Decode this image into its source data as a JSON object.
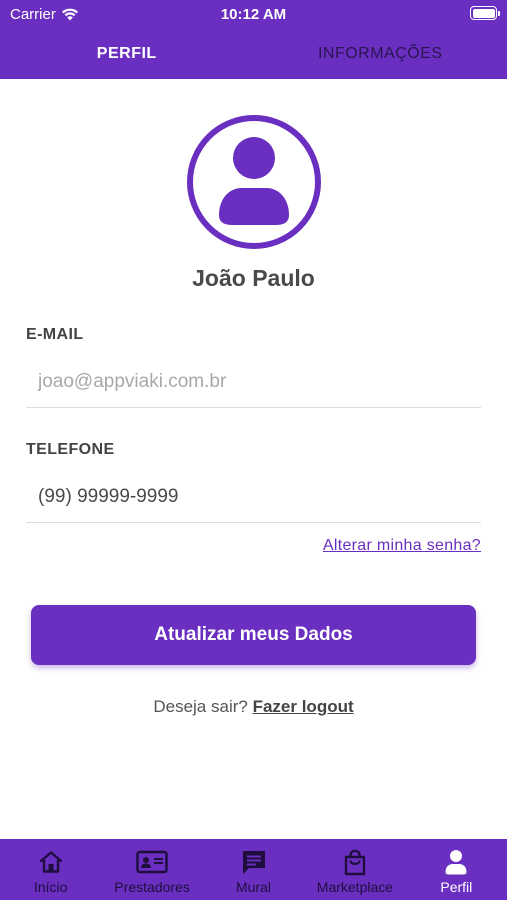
{
  "status_bar": {
    "carrier": "Carrier",
    "time": "10:12 AM"
  },
  "tabs": [
    {
      "label": "PERFIL",
      "active": true
    },
    {
      "label": "INFORMAÇÕES",
      "active": false
    }
  ],
  "profile": {
    "name": "João Paulo",
    "avatar_icon": "user-avatar-icon"
  },
  "form": {
    "email_label": "E-MAIL",
    "email_placeholder": "joao@appviaki.com.br",
    "phone_label": "TELEFONE",
    "phone_value": "(99) 99999-9999",
    "change_password": "Alterar minha senha?"
  },
  "update_button": "Atualizar meus Dados",
  "logout": {
    "prompt": "Deseja sair?",
    "link": "Fazer logout"
  },
  "bottom_nav": [
    {
      "label": "Início",
      "icon": "home-icon",
      "active": false
    },
    {
      "label": "Prestadores",
      "icon": "id-card-icon",
      "active": false
    },
    {
      "label": "Mural",
      "icon": "message-board-icon",
      "active": false
    },
    {
      "label": "Marketplace",
      "icon": "shopping-bag-icon",
      "active": false
    },
    {
      "label": "Perfil",
      "icon": "user-icon",
      "active": true
    }
  ],
  "colors": {
    "primary": "#6a2fc0",
    "nav_inactive_text": "#1e0d3d",
    "text": "#4a4a4a"
  }
}
